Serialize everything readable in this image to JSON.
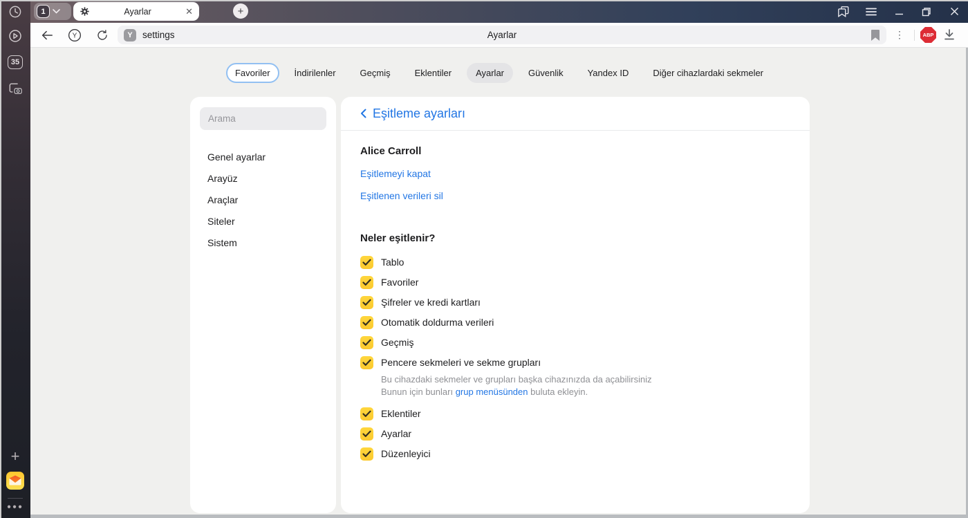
{
  "chrome": {
    "tab_group_count": "1",
    "tab_title": "Ayarlar",
    "sidebar_badge": "35",
    "url_value": "settings",
    "omnibox_title": "Ayarlar",
    "favicon_letter": "Y",
    "yandex_button_letter": "Y",
    "abp_label": "ABP",
    "accent_blue": "#2276e4",
    "checkbox_yellow": "#fcc92e",
    "abp_red": "#dd2c35"
  },
  "nav_tabs": {
    "items": [
      {
        "label": "Favoriler",
        "focused": true
      },
      {
        "label": "İndirilenler"
      },
      {
        "label": "Geçmiş"
      },
      {
        "label": "Eklentiler"
      },
      {
        "label": "Ayarlar",
        "active": true
      },
      {
        "label": "Güvenlik"
      },
      {
        "label": "Yandex ID"
      },
      {
        "label": "Diğer cihazlardaki sekmeler"
      }
    ]
  },
  "settings_sidebar": {
    "search_placeholder": "Arama",
    "items": [
      "Genel ayarlar",
      "Arayüz",
      "Araçlar",
      "Siteler",
      "Sistem"
    ]
  },
  "sync": {
    "title": "Eşitleme ayarları",
    "account_name": "Alice Carroll",
    "link_disable": "Eşitlemeyi kapat",
    "link_delete": "Eşitlenen verileri sil",
    "section_title": "Neler eşitlenir?",
    "items": [
      {
        "label": "Tablo",
        "checked": true
      },
      {
        "label": "Favoriler",
        "checked": true
      },
      {
        "label": "Şifreler ve kredi kartları",
        "checked": true
      },
      {
        "label": "Otomatik doldurma verileri",
        "checked": true
      },
      {
        "label": "Geçmiş",
        "checked": true
      },
      {
        "label": "Pencere sekmeleri ve sekme grupları",
        "checked": true,
        "desc_line1": "Bu cihazdaki sekmeler ve grupları başka cihazınızda da açabilirsiniz",
        "desc_line2_prefix": "Bunun için bunları ",
        "desc_line2_link": "grup menüsünden",
        "desc_line2_suffix": " buluta ekleyin."
      },
      {
        "label": "Eklentiler",
        "checked": true
      },
      {
        "label": "Ayarlar",
        "checked": true
      },
      {
        "label": "Düzenleyici",
        "checked": true
      }
    ]
  }
}
